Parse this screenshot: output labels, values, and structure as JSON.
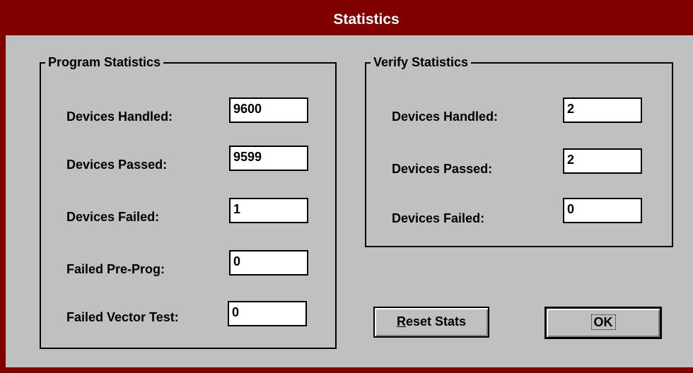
{
  "window": {
    "title": "Statistics"
  },
  "program": {
    "title": "Program Statistics",
    "rows": [
      {
        "label": "Devices Handled:",
        "value": "9600"
      },
      {
        "label": "Devices Passed:",
        "value": "9599"
      },
      {
        "label": "Devices Failed:",
        "value": "1"
      },
      {
        "label": "Failed Pre-Prog:",
        "value": "0"
      },
      {
        "label": "Failed Vector Test:",
        "value": "0"
      }
    ]
  },
  "verify": {
    "title": "Verify Statistics",
    "rows": [
      {
        "label": "Devices Handled:",
        "value": "2"
      },
      {
        "label": "Devices Passed:",
        "value": "2"
      },
      {
        "label": "Devices Failed:",
        "value": "0"
      }
    ]
  },
  "buttons": {
    "reset_mnemonic": "R",
    "reset_rest": "eset Stats",
    "ok": "OK"
  },
  "colors": {
    "titlebar": "#800000",
    "face": "#c0c0c0",
    "field": "#ffffff"
  },
  "icons": {
    "system_menu": "system-menu-icon"
  }
}
